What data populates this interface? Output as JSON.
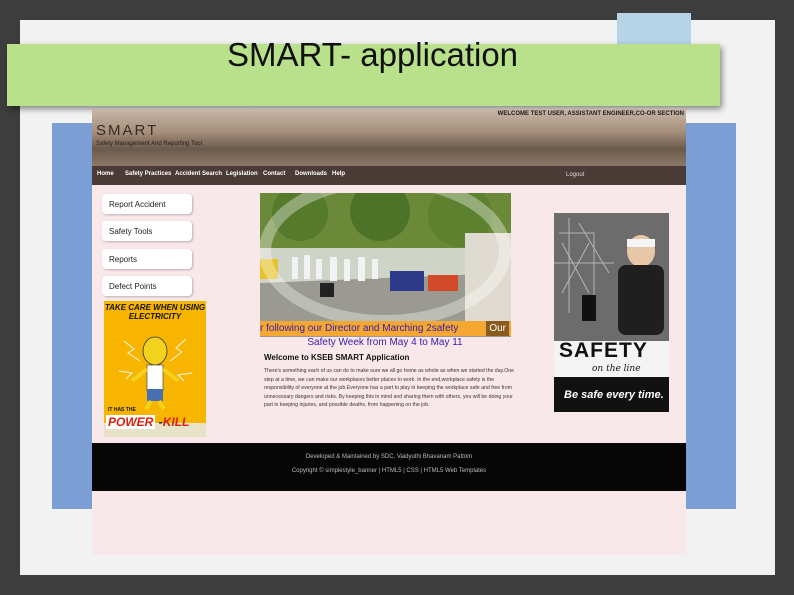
{
  "slide": {
    "title": "SMART- application"
  },
  "app": {
    "welcome_text": "WELCOME TEST USER, ASSISTANT ENGINEER,CO-OR SECTION",
    "brand": "SMART",
    "tagline": "Safety Management And Reporting Tool",
    "nav": [
      "Home",
      "Safety Practices",
      "Accident Search",
      "Legislation",
      "Contact",
      "Downloads",
      "Help"
    ],
    "logout": "Logout"
  },
  "sidebar": {
    "buttons": [
      "Report Accident",
      "Safety Tools",
      "Reports",
      "Defect Points"
    ]
  },
  "poster": {
    "headline": "TAKE CARE WHEN USING ELECTRICITY",
    "subline": "IT HAS THE",
    "power": "POWER",
    "kill": "KILL",
    "icon": "electrocution-cartoon-icon"
  },
  "main": {
    "caption": "r following  our Director and Marching  2safety",
    "caption_tail": "Our",
    "safety_week": "Safety Week from May 4 to May 11",
    "heading": "Welcome to KSEB SMART Application",
    "paragraph": "There's something each of us can do to make sure we all go home as whole as when we started the day.One step at a time, we can make our workplaces better places to work. In the end,workplace safety is the responsibility of everyone at the job.Everyone has a part to play in keeping the workplace safe and free from unnecessary dangers and risks. By keeping this in mind and sharing them with others, you will be doing your part in keeping injuries, and possible deaths, from happening on the job."
  },
  "side_poster": {
    "word": "SAFETY",
    "script": "on the line",
    "slogan": "Be safe every time."
  },
  "footer": {
    "line1": "Developed & Maintained by SDC, Vaidyuthi Bhavanam Pattom",
    "line2": "Copyright © simplestyle_banner | HTML5 | CSS | HTML5 Web Templates"
  },
  "colors": {
    "title_banner": "#b9e08a",
    "nav_bar": "#4a3b36",
    "page_bg": "#f9e8e9",
    "caption_bg": "#f4a833",
    "caption_text": "#3a1aa8",
    "poster_bg": "#f7b500"
  }
}
